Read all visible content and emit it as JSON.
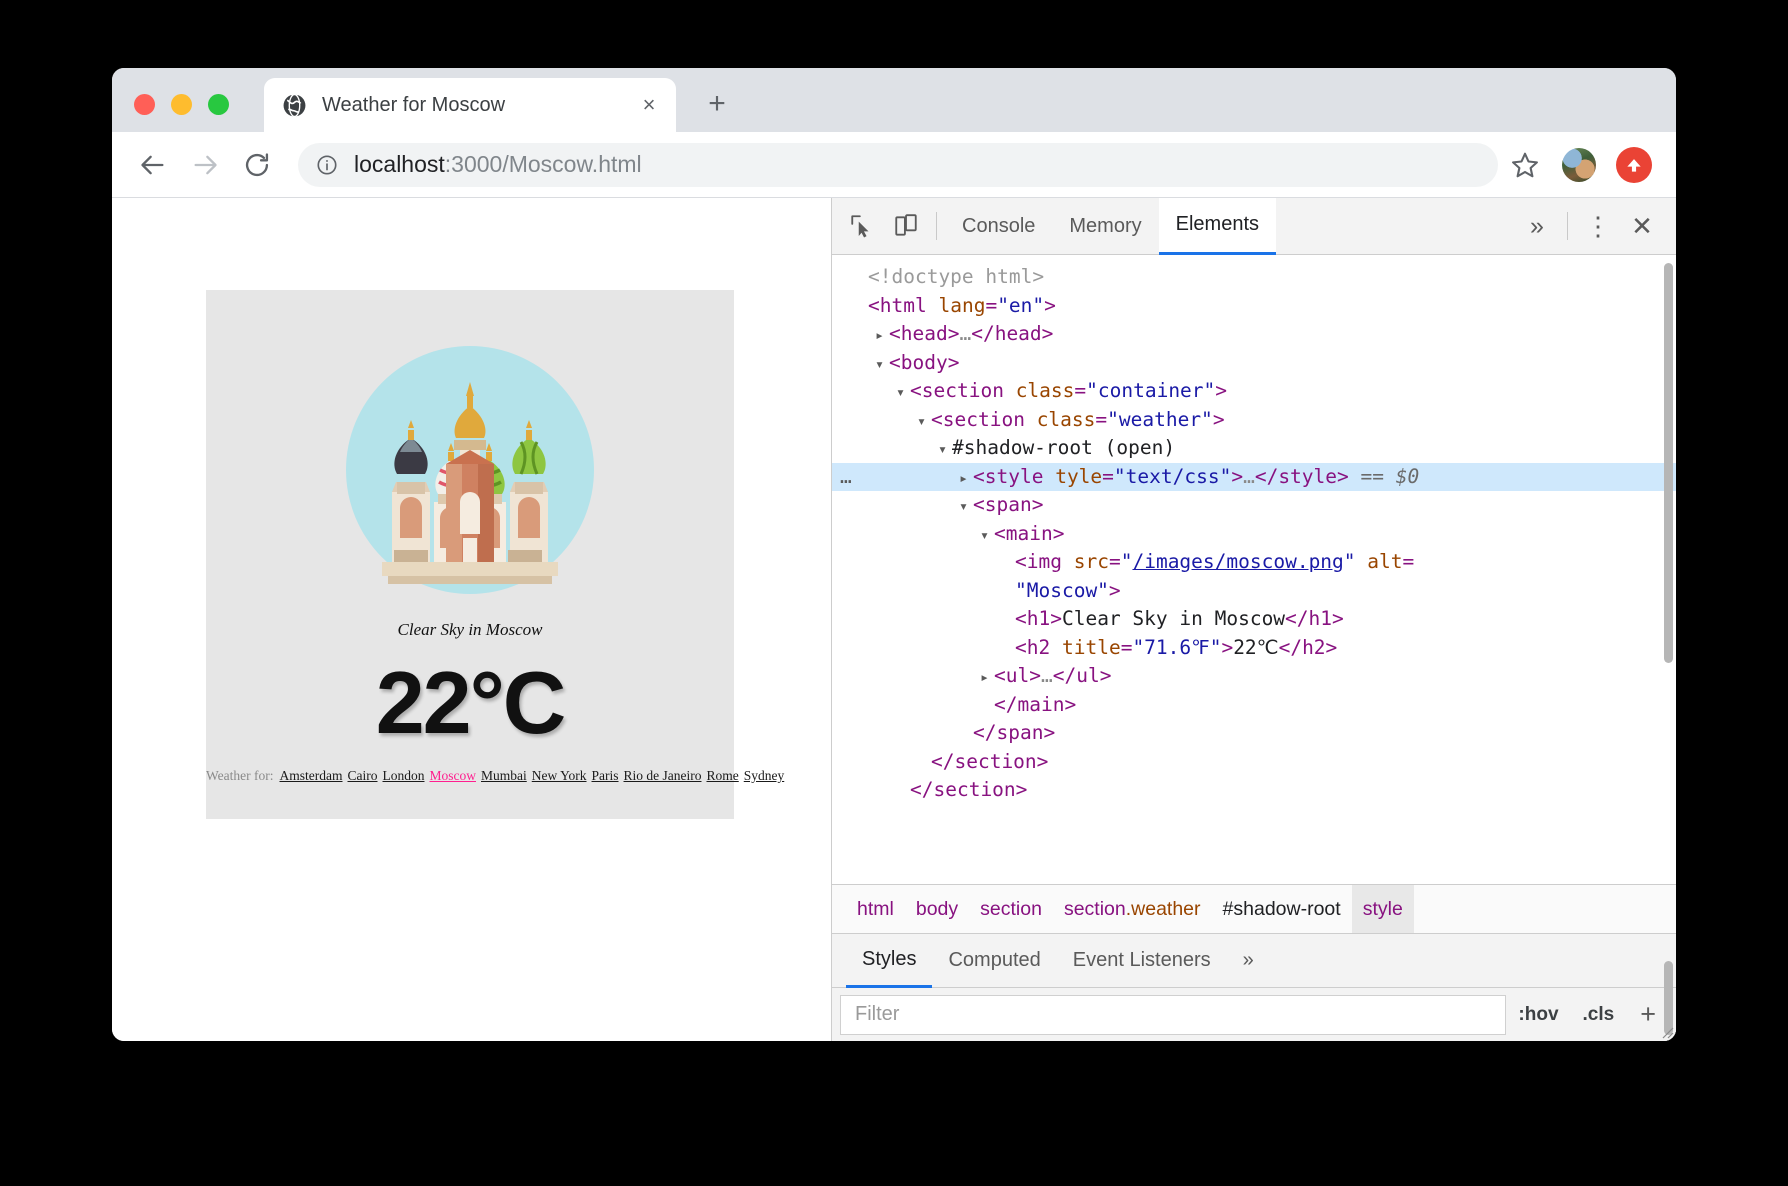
{
  "browser": {
    "tab": {
      "title": "Weather for Moscow",
      "favicon": "globe-icon",
      "close": "×"
    },
    "new_tab": "+",
    "toolbar": {
      "back": "←",
      "forward": "→",
      "reload": "↻",
      "info_icon": "info-circle-icon",
      "url_host": "localhost",
      "url_rest": ":3000/Moscow.html",
      "bookmark": "star-icon",
      "profile": "avatar",
      "update": "update-available-icon"
    }
  },
  "page": {
    "caption": "Clear Sky in Moscow",
    "temperature": "22°C",
    "illustration_alt": "Moscow",
    "city_links_label": "Weather for:",
    "cities": [
      {
        "name": "Amsterdam",
        "current": false
      },
      {
        "name": "Cairo",
        "current": false
      },
      {
        "name": "London",
        "current": false
      },
      {
        "name": "Moscow",
        "current": true
      },
      {
        "name": "Mumbai",
        "current": false
      },
      {
        "name": "New York",
        "current": false
      },
      {
        "name": "Paris",
        "current": false
      },
      {
        "name": "Rio de Janeiro",
        "current": false
      },
      {
        "name": "Rome",
        "current": false
      },
      {
        "name": "Sydney",
        "current": false
      }
    ],
    "current_city_color": "#ff1f8f"
  },
  "devtools": {
    "toolbar": {
      "inspect_icon": "inspect-element-icon",
      "device_icon": "device-toolbar-icon",
      "tabs": [
        {
          "label": "Console",
          "active": false
        },
        {
          "label": "Memory",
          "active": false
        },
        {
          "label": "Elements",
          "active": true
        }
      ],
      "more_tabs": "»",
      "menu": "⋮",
      "close": "✕"
    },
    "dom_lines": [
      {
        "indent": 0,
        "twisty": "",
        "selected": false,
        "tokens": [
          {
            "t": "doctype",
            "v": "<!doctype html>"
          }
        ]
      },
      {
        "indent": 0,
        "twisty": "",
        "selected": false,
        "tokens": [
          {
            "t": "punc",
            "v": "<"
          },
          {
            "t": "tag",
            "v": "html"
          },
          {
            "t": "sp",
            "v": " "
          },
          {
            "t": "attr",
            "v": "lang"
          },
          {
            "t": "punc2",
            "v": "="
          },
          {
            "t": "val",
            "v": "\"en\""
          },
          {
            "t": "punc",
            "v": ">"
          }
        ]
      },
      {
        "indent": 1,
        "twisty": "▸",
        "selected": false,
        "tokens": [
          {
            "t": "punc",
            "v": "<"
          },
          {
            "t": "tag",
            "v": "head"
          },
          {
            "t": "punc",
            "v": ">"
          },
          {
            "t": "ellipsis",
            "v": "…"
          },
          {
            "t": "punc",
            "v": "</"
          },
          {
            "t": "tag",
            "v": "head"
          },
          {
            "t": "punc",
            "v": ">"
          }
        ]
      },
      {
        "indent": 1,
        "twisty": "▾",
        "selected": false,
        "tokens": [
          {
            "t": "punc",
            "v": "<"
          },
          {
            "t": "tag",
            "v": "body"
          },
          {
            "t": "punc",
            "v": ">"
          }
        ]
      },
      {
        "indent": 2,
        "twisty": "▾",
        "selected": false,
        "tokens": [
          {
            "t": "punc",
            "v": "<"
          },
          {
            "t": "tag",
            "v": "section"
          },
          {
            "t": "sp",
            "v": " "
          },
          {
            "t": "attr",
            "v": "class"
          },
          {
            "t": "punc2",
            "v": "="
          },
          {
            "t": "val",
            "v": "\"container\""
          },
          {
            "t": "punc",
            "v": ">"
          }
        ]
      },
      {
        "indent": 3,
        "twisty": "▾",
        "selected": false,
        "tokens": [
          {
            "t": "punc",
            "v": "<"
          },
          {
            "t": "tag",
            "v": "section"
          },
          {
            "t": "sp",
            "v": " "
          },
          {
            "t": "attr",
            "v": "class"
          },
          {
            "t": "punc2",
            "v": "="
          },
          {
            "t": "val",
            "v": "\"weather\""
          },
          {
            "t": "punc",
            "v": ">"
          }
        ]
      },
      {
        "indent": 4,
        "twisty": "▾",
        "selected": false,
        "tokens": [
          {
            "t": "shadow",
            "v": "#shadow-root (open)"
          }
        ]
      },
      {
        "indent": 5,
        "twisty": "▸",
        "selected": true,
        "gutter": "…",
        "tokens": [
          {
            "t": "punc",
            "v": "<"
          },
          {
            "t": "tag",
            "v": "style"
          },
          {
            "t": "sp",
            "v": " "
          },
          {
            "t": "attr",
            "v": "tyle"
          },
          {
            "t": "punc2",
            "v": "="
          },
          {
            "t": "val",
            "v": "\"text/css\""
          },
          {
            "t": "punc",
            "v": ">"
          },
          {
            "t": "ellipsis",
            "v": "…"
          },
          {
            "t": "punc",
            "v": "</"
          },
          {
            "t": "tag",
            "v": "style"
          },
          {
            "t": "punc",
            "v": ">"
          },
          {
            "t": "sp",
            "v": " "
          },
          {
            "t": "sel",
            "v": "== $0"
          }
        ]
      },
      {
        "indent": 5,
        "twisty": "▾",
        "selected": false,
        "tokens": [
          {
            "t": "punc",
            "v": "<"
          },
          {
            "t": "tag",
            "v": "span"
          },
          {
            "t": "punc",
            "v": ">"
          }
        ]
      },
      {
        "indent": 6,
        "twisty": "▾",
        "selected": false,
        "tokens": [
          {
            "t": "punc",
            "v": "<"
          },
          {
            "t": "tag",
            "v": "main"
          },
          {
            "t": "punc",
            "v": ">"
          }
        ]
      },
      {
        "indent": 7,
        "twisty": "",
        "selected": false,
        "tokens": [
          {
            "t": "punc",
            "v": "<"
          },
          {
            "t": "tag",
            "v": "img"
          },
          {
            "t": "sp",
            "v": " "
          },
          {
            "t": "attr",
            "v": "src"
          },
          {
            "t": "punc2",
            "v": "="
          },
          {
            "t": "val",
            "v": "\""
          },
          {
            "t": "link",
            "v": "/images/moscow.png"
          },
          {
            "t": "val",
            "v": "\""
          },
          {
            "t": "sp",
            "v": " "
          },
          {
            "t": "attr",
            "v": "alt"
          },
          {
            "t": "punc2",
            "v": "="
          }
        ]
      },
      {
        "indent": 7,
        "twisty": "",
        "selected": false,
        "cont": true,
        "tokens": [
          {
            "t": "val",
            "v": "\"Moscow\""
          },
          {
            "t": "punc",
            "v": ">"
          }
        ]
      },
      {
        "indent": 7,
        "twisty": "",
        "selected": false,
        "cont": true,
        "tokens": [
          {
            "t": "punc",
            "v": "<"
          },
          {
            "t": "tag",
            "v": "h1"
          },
          {
            "t": "punc",
            "v": ">"
          },
          {
            "t": "text",
            "v": "Clear Sky in Moscow"
          },
          {
            "t": "punc",
            "v": "</"
          },
          {
            "t": "tag",
            "v": "h1"
          },
          {
            "t": "punc",
            "v": ">"
          }
        ]
      },
      {
        "indent": 7,
        "twisty": "",
        "selected": false,
        "cont": true,
        "tokens": [
          {
            "t": "punc",
            "v": "<"
          },
          {
            "t": "tag",
            "v": "h2"
          },
          {
            "t": "sp",
            "v": " "
          },
          {
            "t": "attr",
            "v": "title"
          },
          {
            "t": "punc2",
            "v": "="
          },
          {
            "t": "val",
            "v": "\"71.6℉\""
          },
          {
            "t": "punc",
            "v": ">"
          },
          {
            "t": "text",
            "v": "22℃"
          },
          {
            "t": "punc",
            "v": "</"
          },
          {
            "t": "tag",
            "v": "h2"
          },
          {
            "t": "punc",
            "v": ">"
          }
        ]
      },
      {
        "indent": 6,
        "twisty": "▸",
        "selected": false,
        "tokens": [
          {
            "t": "punc",
            "v": "<"
          },
          {
            "t": "tag",
            "v": "ul"
          },
          {
            "t": "punc",
            "v": ">"
          },
          {
            "t": "ellipsis",
            "v": "…"
          },
          {
            "t": "punc",
            "v": "</"
          },
          {
            "t": "tag",
            "v": "ul"
          },
          {
            "t": "punc",
            "v": ">"
          }
        ]
      },
      {
        "indent": 6,
        "twisty": "",
        "selected": false,
        "tokens": [
          {
            "t": "punc",
            "v": "</"
          },
          {
            "t": "tag",
            "v": "main"
          },
          {
            "t": "punc",
            "v": ">"
          }
        ]
      },
      {
        "indent": 5,
        "twisty": "",
        "selected": false,
        "tokens": [
          {
            "t": "punc",
            "v": "</"
          },
          {
            "t": "tag",
            "v": "span"
          },
          {
            "t": "punc",
            "v": ">"
          }
        ]
      },
      {
        "indent": 3,
        "twisty": "",
        "selected": false,
        "tokens": [
          {
            "t": "punc",
            "v": "</"
          },
          {
            "t": "tag",
            "v": "section"
          },
          {
            "t": "punc",
            "v": ">"
          }
        ]
      },
      {
        "indent": 2,
        "twisty": "",
        "selected": false,
        "tokens": [
          {
            "t": "punc",
            "v": "</"
          },
          {
            "t": "tag",
            "v": "section"
          },
          {
            "t": "punc",
            "v": ">"
          }
        ]
      }
    ],
    "breadcrumb": [
      {
        "label": "html",
        "cls": "",
        "kind": "tag"
      },
      {
        "label": "body",
        "cls": "",
        "kind": "tag"
      },
      {
        "label": "section",
        "cls": "",
        "kind": "tag"
      },
      {
        "label": "section",
        "cls": ".weather",
        "kind": "tag"
      },
      {
        "label": "#shadow-root",
        "cls": "",
        "kind": "shadow"
      },
      {
        "label": "style",
        "cls": "",
        "kind": "last"
      }
    ],
    "styles_tabs": [
      {
        "label": "Styles",
        "active": true
      },
      {
        "label": "Computed",
        "active": false
      },
      {
        "label": "Event Listeners",
        "active": false
      }
    ],
    "styles_more": "»",
    "filter_placeholder": "Filter",
    "hov_label": ":hov",
    "cls_label": ".cls",
    "add_rule": "+"
  },
  "colors": {
    "accent": "#1a73e8",
    "tag": "#881280",
    "attr": "#994500",
    "value": "#1a1aa6",
    "selected_row": "#cfe8fc",
    "pink": "#ff1f8f"
  }
}
